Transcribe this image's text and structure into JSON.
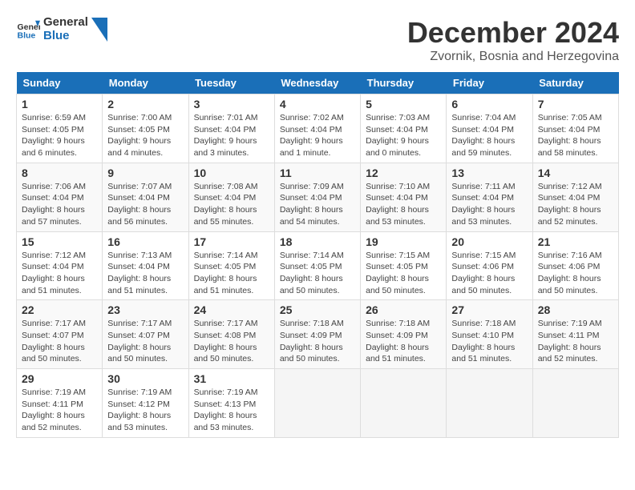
{
  "header": {
    "logo_general": "General",
    "logo_blue": "Blue",
    "month_title": "December 2024",
    "location": "Zvornik, Bosnia and Herzegovina"
  },
  "days_of_week": [
    "Sunday",
    "Monday",
    "Tuesday",
    "Wednesday",
    "Thursday",
    "Friday",
    "Saturday"
  ],
  "weeks": [
    [
      {
        "day": "1",
        "sunrise": "6:59 AM",
        "sunset": "4:05 PM",
        "daylight": "9 hours and 6 minutes."
      },
      {
        "day": "2",
        "sunrise": "7:00 AM",
        "sunset": "4:05 PM",
        "daylight": "9 hours and 4 minutes."
      },
      {
        "day": "3",
        "sunrise": "7:01 AM",
        "sunset": "4:04 PM",
        "daylight": "9 hours and 3 minutes."
      },
      {
        "day": "4",
        "sunrise": "7:02 AM",
        "sunset": "4:04 PM",
        "daylight": "9 hours and 1 minute."
      },
      {
        "day": "5",
        "sunrise": "7:03 AM",
        "sunset": "4:04 PM",
        "daylight": "9 hours and 0 minutes."
      },
      {
        "day": "6",
        "sunrise": "7:04 AM",
        "sunset": "4:04 PM",
        "daylight": "8 hours and 59 minutes."
      },
      {
        "day": "7",
        "sunrise": "7:05 AM",
        "sunset": "4:04 PM",
        "daylight": "8 hours and 58 minutes."
      }
    ],
    [
      {
        "day": "8",
        "sunrise": "7:06 AM",
        "sunset": "4:04 PM",
        "daylight": "8 hours and 57 minutes."
      },
      {
        "day": "9",
        "sunrise": "7:07 AM",
        "sunset": "4:04 PM",
        "daylight": "8 hours and 56 minutes."
      },
      {
        "day": "10",
        "sunrise": "7:08 AM",
        "sunset": "4:04 PM",
        "daylight": "8 hours and 55 minutes."
      },
      {
        "day": "11",
        "sunrise": "7:09 AM",
        "sunset": "4:04 PM",
        "daylight": "8 hours and 54 minutes."
      },
      {
        "day": "12",
        "sunrise": "7:10 AM",
        "sunset": "4:04 PM",
        "daylight": "8 hours and 53 minutes."
      },
      {
        "day": "13",
        "sunrise": "7:11 AM",
        "sunset": "4:04 PM",
        "daylight": "8 hours and 53 minutes."
      },
      {
        "day": "14",
        "sunrise": "7:12 AM",
        "sunset": "4:04 PM",
        "daylight": "8 hours and 52 minutes."
      }
    ],
    [
      {
        "day": "15",
        "sunrise": "7:12 AM",
        "sunset": "4:04 PM",
        "daylight": "8 hours and 51 minutes."
      },
      {
        "day": "16",
        "sunrise": "7:13 AM",
        "sunset": "4:04 PM",
        "daylight": "8 hours and 51 minutes."
      },
      {
        "day": "17",
        "sunrise": "7:14 AM",
        "sunset": "4:05 PM",
        "daylight": "8 hours and 51 minutes."
      },
      {
        "day": "18",
        "sunrise": "7:14 AM",
        "sunset": "4:05 PM",
        "daylight": "8 hours and 50 minutes."
      },
      {
        "day": "19",
        "sunrise": "7:15 AM",
        "sunset": "4:05 PM",
        "daylight": "8 hours and 50 minutes."
      },
      {
        "day": "20",
        "sunrise": "7:15 AM",
        "sunset": "4:06 PM",
        "daylight": "8 hours and 50 minutes."
      },
      {
        "day": "21",
        "sunrise": "7:16 AM",
        "sunset": "4:06 PM",
        "daylight": "8 hours and 50 minutes."
      }
    ],
    [
      {
        "day": "22",
        "sunrise": "7:17 AM",
        "sunset": "4:07 PM",
        "daylight": "8 hours and 50 minutes."
      },
      {
        "day": "23",
        "sunrise": "7:17 AM",
        "sunset": "4:07 PM",
        "daylight": "8 hours and 50 minutes."
      },
      {
        "day": "24",
        "sunrise": "7:17 AM",
        "sunset": "4:08 PM",
        "daylight": "8 hours and 50 minutes."
      },
      {
        "day": "25",
        "sunrise": "7:18 AM",
        "sunset": "4:09 PM",
        "daylight": "8 hours and 50 minutes."
      },
      {
        "day": "26",
        "sunrise": "7:18 AM",
        "sunset": "4:09 PM",
        "daylight": "8 hours and 51 minutes."
      },
      {
        "day": "27",
        "sunrise": "7:18 AM",
        "sunset": "4:10 PM",
        "daylight": "8 hours and 51 minutes."
      },
      {
        "day": "28",
        "sunrise": "7:19 AM",
        "sunset": "4:11 PM",
        "daylight": "8 hours and 52 minutes."
      }
    ],
    [
      {
        "day": "29",
        "sunrise": "7:19 AM",
        "sunset": "4:11 PM",
        "daylight": "8 hours and 52 minutes."
      },
      {
        "day": "30",
        "sunrise": "7:19 AM",
        "sunset": "4:12 PM",
        "daylight": "8 hours and 53 minutes."
      },
      {
        "day": "31",
        "sunrise": "7:19 AM",
        "sunset": "4:13 PM",
        "daylight": "8 hours and 53 minutes."
      },
      null,
      null,
      null,
      null
    ]
  ]
}
